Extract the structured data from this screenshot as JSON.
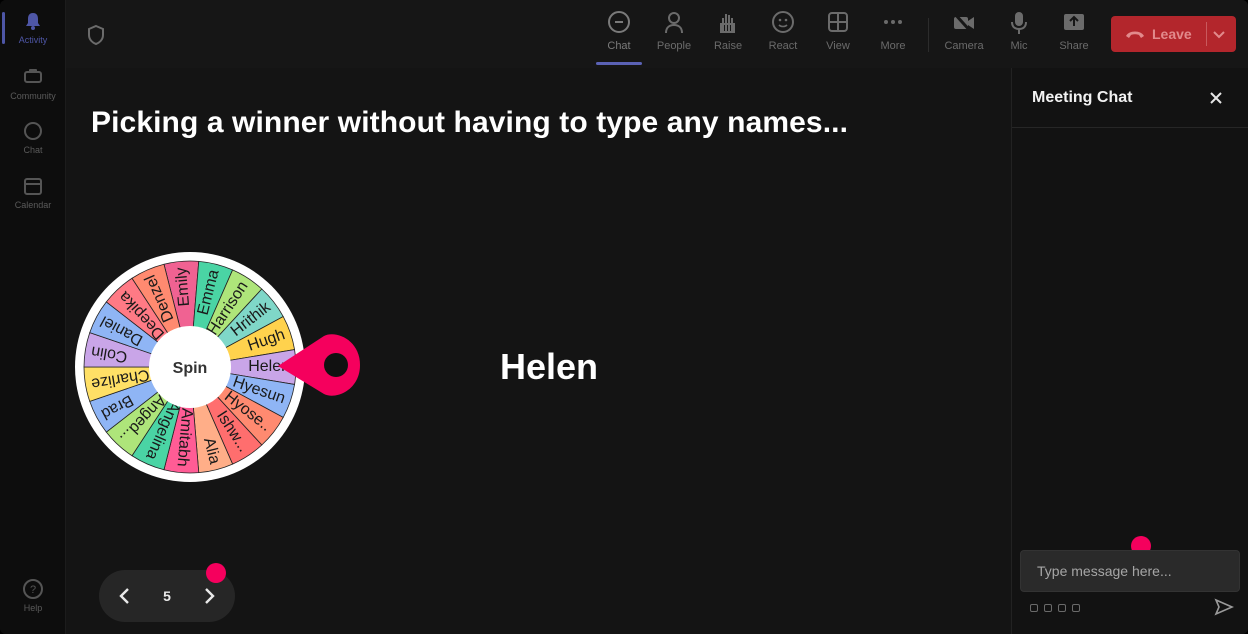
{
  "rail": {
    "items": [
      {
        "label": "Activity",
        "icon": "bell-icon",
        "active": true
      },
      {
        "label": "Community",
        "icon": "community-icon"
      },
      {
        "label": "Chat",
        "icon": "chat-icon"
      },
      {
        "label": "Calendar",
        "icon": "calendar-icon"
      }
    ],
    "help": "Help"
  },
  "toolbar": {
    "buttons": [
      {
        "label": "Chat",
        "icon": "chat-bubble-icon"
      },
      {
        "label": "People",
        "icon": "people-icon"
      },
      {
        "label": "Raise",
        "icon": "raise-hand-icon"
      },
      {
        "label": "React",
        "icon": "smiley-icon"
      },
      {
        "label": "View",
        "icon": "grid-icon"
      },
      {
        "label": "More",
        "icon": "more-icon"
      },
      {
        "label": "Camera",
        "icon": "camera-off-icon"
      },
      {
        "label": "Mic",
        "icon": "mic-icon"
      },
      {
        "label": "Share",
        "icon": "share-icon"
      }
    ],
    "leave_label": "Leave"
  },
  "slide": {
    "title": "Picking a winner without having to type any names...",
    "spin_label": "Spin",
    "winner": "Helen",
    "wheel_names": [
      "Emily",
      "Emma",
      "Harrison",
      "Hrithik",
      "Hugh",
      "Helen",
      "Hyesun",
      "Hyose..",
      "Ishw...",
      "Alia",
      "Amitabh",
      "Angelina",
      "Anged...",
      "Brad",
      "Charlize",
      "Colin",
      "Daniel",
      "Deepika",
      "Denzel"
    ],
    "wheel_colors": [
      "#f06292",
      "#4ad4a4",
      "#aee57a",
      "#7fd7c8",
      "#ffd24d",
      "#c9a5e8",
      "#8fb5f5",
      "#ff8a70",
      "#ff6e6e",
      "#ffae88",
      "#ff5c95",
      "#4ad4a4",
      "#aee57a",
      "#8fb5f5",
      "#ffe066",
      "#c9a5e8",
      "#8fb5f5",
      "#ff7a85",
      "#ff8a70"
    ]
  },
  "pager": {
    "page": "5"
  },
  "chat": {
    "title": "Meeting Chat",
    "placeholder": "Type message here..."
  }
}
